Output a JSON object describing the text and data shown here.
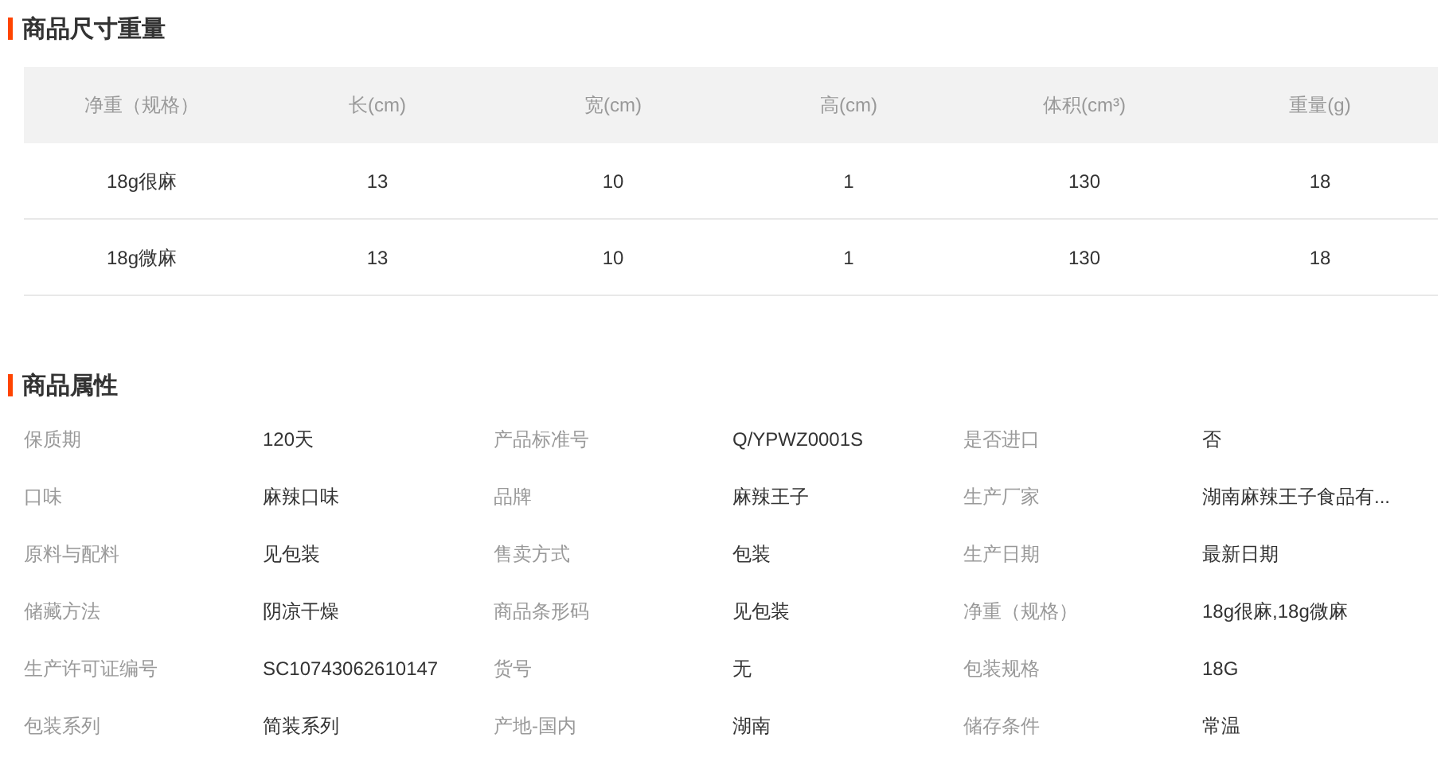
{
  "size_section": {
    "title": "商品尺寸重量",
    "columns": [
      "净重（规格）",
      "长(cm)",
      "宽(cm)",
      "高(cm)",
      "体积(cm³)",
      "重量(g)"
    ],
    "rows": [
      [
        "18g很麻",
        "13",
        "10",
        "1",
        "130",
        "18"
      ],
      [
        "18g微麻",
        "13",
        "10",
        "1",
        "130",
        "18"
      ]
    ]
  },
  "attributes_section": {
    "title": "商品属性",
    "rows": [
      [
        {
          "label": "保质期",
          "value": "120天"
        },
        {
          "label": "产品标准号",
          "value": "Q/YPWZ0001S"
        },
        {
          "label": "是否进口",
          "value": "否"
        }
      ],
      [
        {
          "label": "口味",
          "value": "麻辣口味"
        },
        {
          "label": "品牌",
          "value": "麻辣王子"
        },
        {
          "label": "生产厂家",
          "value": "湖南麻辣王子食品有..."
        }
      ],
      [
        {
          "label": "原料与配料",
          "value": "见包装"
        },
        {
          "label": "售卖方式",
          "value": "包装"
        },
        {
          "label": "生产日期",
          "value": "最新日期"
        }
      ],
      [
        {
          "label": "储藏方法",
          "value": "阴凉干燥"
        },
        {
          "label": "商品条形码",
          "value": "见包装"
        },
        {
          "label": "净重（规格）",
          "value": "18g很麻,18g微麻"
        }
      ],
      [
        {
          "label": "生产许可证编号",
          "value": "SC10743062610147"
        },
        {
          "label": "货号",
          "value": "无"
        },
        {
          "label": "包装规格",
          "value": "18G"
        }
      ],
      [
        {
          "label": "包装系列",
          "value": "简装系列"
        },
        {
          "label": "产地-国内",
          "value": "湖南"
        },
        {
          "label": "储存条件",
          "value": "常温"
        }
      ]
    ]
  }
}
